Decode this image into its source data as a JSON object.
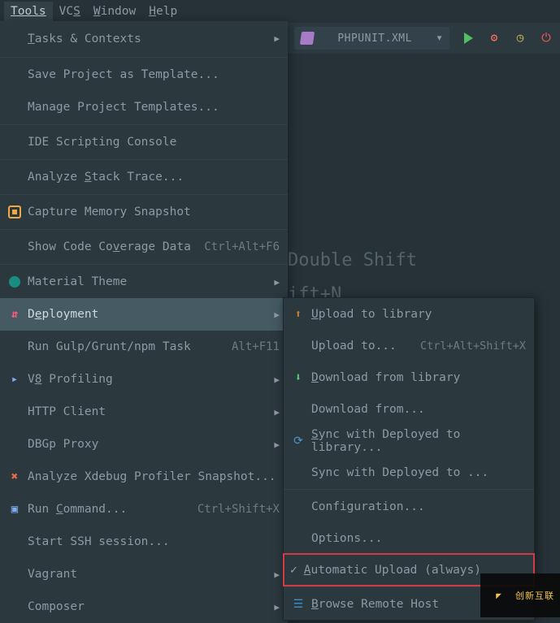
{
  "menubar": {
    "tools": "Tools",
    "vcs": [
      "VC",
      "S"
    ],
    "window": [
      "W",
      "indow"
    ],
    "help": [
      "H",
      "elp"
    ]
  },
  "toolbar": {
    "config_label": "PHPUNIT.XML"
  },
  "hints": {
    "l1": "Double Shift",
    "l2": "ift+N"
  },
  "tools_menu": {
    "tasks": [
      "T",
      "asks & Contexts"
    ],
    "save_tpl": "Save Project as Template...",
    "manage_tpl": "Manage Project Templates...",
    "ide_console": "IDE Scripting Console",
    "analyze_stack": [
      "Analyze ",
      "S",
      "tack Trace..."
    ],
    "capture_mem": "Capture Memory Snapshot",
    "coverage": [
      "Show Code Co",
      "v",
      "erage Data"
    ],
    "coverage_sc": "Ctrl+Alt+F6",
    "material": "Material Theme",
    "deployment": [
      "D",
      "e",
      "ployment"
    ],
    "gulp": "Run Gulp/Grunt/npm Task",
    "gulp_sc": "Alt+F11",
    "v8": [
      "V",
      "8",
      " Profiling"
    ],
    "http": "HTTP Client",
    "dbgp": "DBGp Proxy",
    "xdebug": "Analyze Xdebug Profiler Snapshot...",
    "run_cmd": [
      "Run ",
      "C",
      "ommand..."
    ],
    "run_cmd_sc": "Ctrl+Shift+X",
    "ssh": "Start SSH session...",
    "vagrant": "Vagrant",
    "composer": "Composer"
  },
  "deploy_menu": {
    "upload_lib": [
      "U",
      "pload to library"
    ],
    "upload_to": "Upload to...",
    "upload_to_sc": "Ctrl+Alt+Shift+X",
    "download_lib": [
      "D",
      "ownload from library"
    ],
    "download_from": "Download from...",
    "sync_lib": [
      "S",
      "ync with Deployed to library..."
    ],
    "sync_to": "Sync with Deployed to ...",
    "config": "Configuration...",
    "options": "Options...",
    "auto": [
      "A",
      "utomatic Upload (always)"
    ],
    "browse": [
      "B",
      "rowse Remote Host"
    ]
  },
  "watermark": "创新互联"
}
